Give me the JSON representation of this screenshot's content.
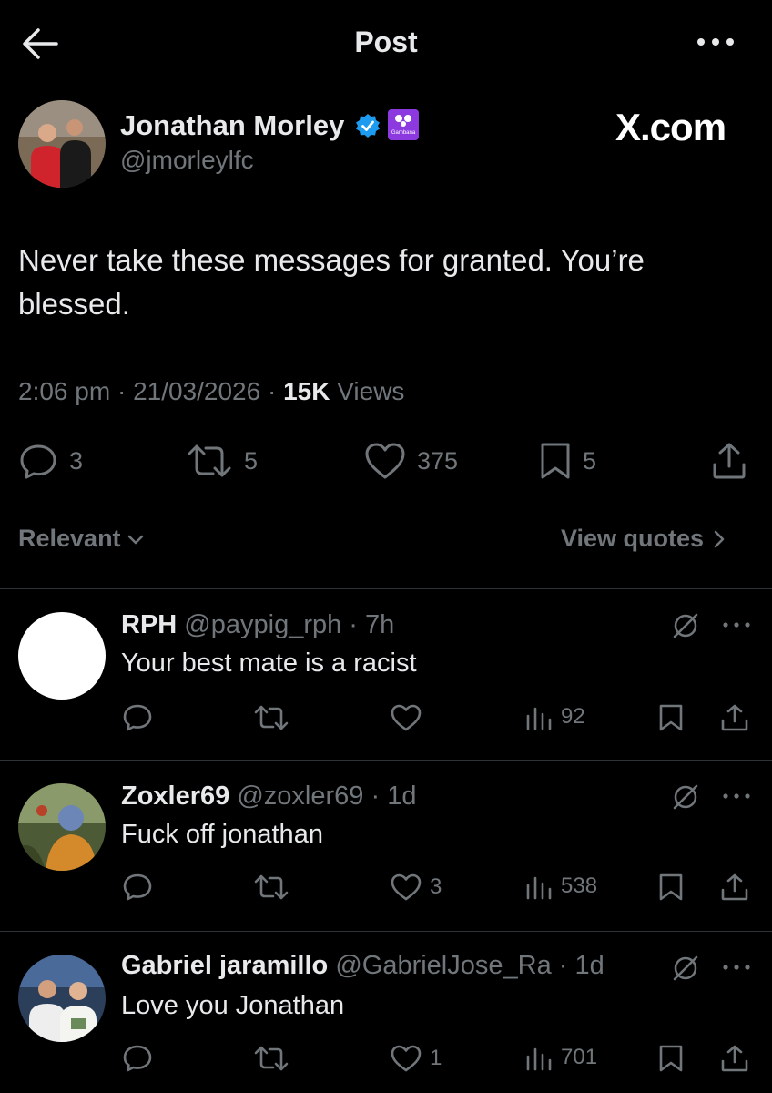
{
  "header": {
    "title": "Post",
    "back_icon": "arrow-left-icon",
    "more_icon": "more-horizontal-icon"
  },
  "watermark": "X.com",
  "tweet": {
    "author_name": "Jonathan Morley",
    "handle": "@jmorleylfc",
    "affiliation_label": "Gambana",
    "text": "Never take these messages for granted. You’re blessed.",
    "time": "2:06 pm",
    "date": "21/03/2026",
    "views_count": "15K",
    "views_label": "Views",
    "replies": "3",
    "reposts": "5",
    "likes": "375",
    "bookmarks": "5"
  },
  "sort": {
    "label": "Relevant",
    "view_quotes": "View quotes"
  },
  "replies": [
    {
      "name": "RPH",
      "handle": "@paypig_rph",
      "time": "7h",
      "text": "Your best mate is a racist",
      "likes": "",
      "views": "92"
    },
    {
      "name": "Zoxler69",
      "handle": "@zoxler69",
      "time": "1d",
      "text": "Fuck off jonathan",
      "likes": "3",
      "views": "538"
    },
    {
      "name": "Gabriel jaramillo",
      "handle": "@GabrielJose_Ra",
      "time": "1d",
      "text": "Love you Jonathan",
      "likes": "1",
      "views": "701"
    }
  ],
  "colors": {
    "background": "#000000",
    "text": "#e7e9ea",
    "muted": "#71767b",
    "verified": "#1d9bf0",
    "affiliate": "#8c3ae0"
  }
}
